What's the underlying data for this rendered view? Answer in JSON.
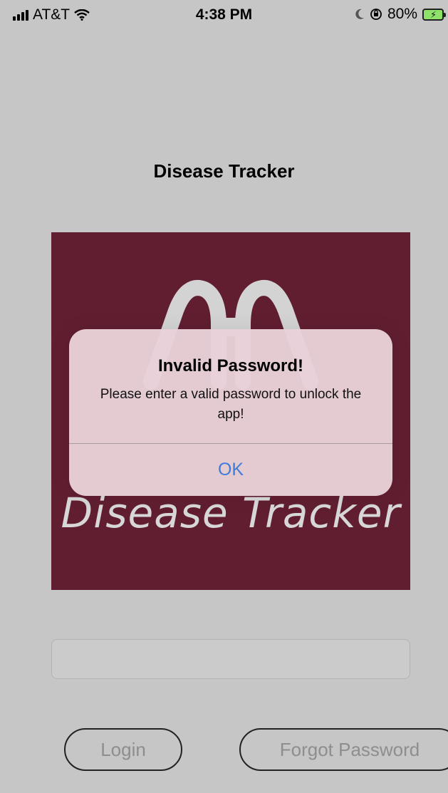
{
  "status_bar": {
    "carrier": "AT&T",
    "time": "4:38 PM",
    "battery": "80%",
    "icons": [
      "signal-bars-icon",
      "wifi-icon",
      "moon-icon",
      "orientation-lock-icon",
      "battery-charging-icon"
    ]
  },
  "app": {
    "title": "Disease Tracker",
    "logo_text": "Disease Tracker",
    "brand_color": "#611e31",
    "password_value": "",
    "login_label": "Login",
    "forgot_label": "Forgot Password"
  },
  "alert": {
    "title": "Invalid Password!",
    "message": "Please enter a valid password to unlock the app!",
    "ok_label": "OK",
    "ok_color": "#3f7bd8"
  }
}
